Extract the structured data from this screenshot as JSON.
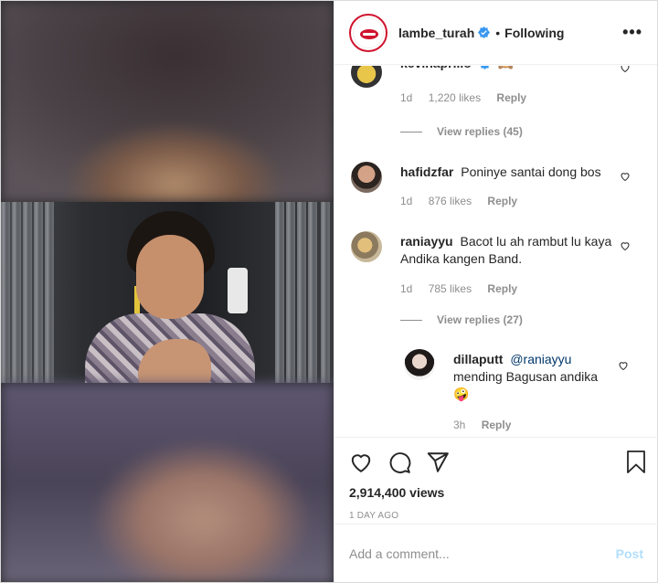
{
  "header": {
    "username": "lambe_turah",
    "separator": "•",
    "follow_status": "Following",
    "more_label": "•••"
  },
  "comments": [
    {
      "username": "kevinaprilio",
      "text": "🙈",
      "time": "1d",
      "likes": "1,220 likes",
      "reply_label": "Reply",
      "verified": true,
      "view_replies": "View replies (45)"
    },
    {
      "username": "hafidzfar",
      "text": "Poninye santai dong bos",
      "time": "1d",
      "likes": "876 likes",
      "reply_label": "Reply"
    },
    {
      "username": "raniayyu",
      "text": "Bacot lu ah rambut lu kaya Andika kangen Band.",
      "time": "1d",
      "likes": "785 likes",
      "reply_label": "Reply",
      "view_replies": "View replies (27)"
    },
    {
      "username": "dillaputt",
      "mention": "@raniayyu",
      "text": "mending Bagusan andika",
      "emoji": "🤪",
      "time": "3h",
      "reply_label": "Reply"
    }
  ],
  "actions": {
    "views": "2,914,400 views",
    "date": "1 DAY AGO"
  },
  "add_comment": {
    "placeholder": "Add a comment...",
    "post_label": "Post"
  },
  "colors": {
    "brand_red": "#d0142e",
    "verified_blue": "#3897f0",
    "post_disabled": "#b2dffc",
    "muted_text": "#8e8e8e"
  }
}
